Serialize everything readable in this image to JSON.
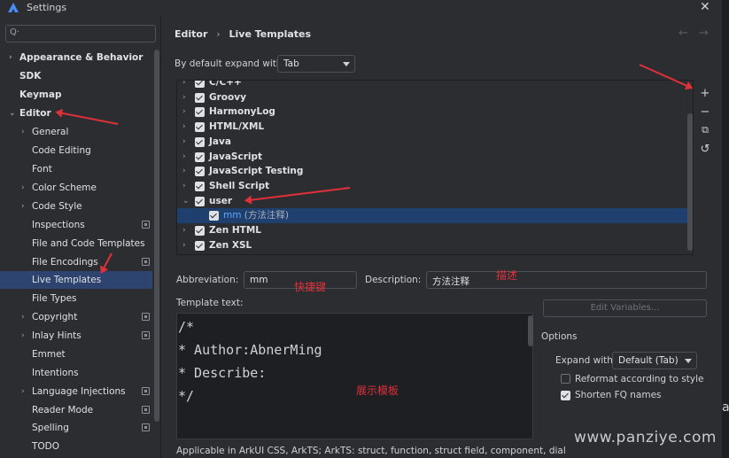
{
  "window": {
    "title": "Settings",
    "close": "✕"
  },
  "search": {
    "icon": "search-icon",
    "placeholder": "Q·"
  },
  "sidebar": {
    "items": [
      {
        "label": "Appearance & Behavior",
        "chevron": "›",
        "bold": true
      },
      {
        "label": "SDK",
        "bold": true
      },
      {
        "label": "Keymap",
        "bold": true
      },
      {
        "label": "Editor",
        "chevron": "⌄",
        "bold": true
      },
      {
        "label": "General",
        "chevron": "›"
      },
      {
        "label": "Code Editing"
      },
      {
        "label": "Font"
      },
      {
        "label": "Color Scheme",
        "chevron": "›"
      },
      {
        "label": "Code Style",
        "chevron": "›"
      },
      {
        "label": "Inspections",
        "badge": true
      },
      {
        "label": "File and Code Templates"
      },
      {
        "label": "File Encodings",
        "badge": true
      },
      {
        "label": "Live Templates",
        "selected": true
      },
      {
        "label": "File Types"
      },
      {
        "label": "Copyright",
        "chevron": "›",
        "badge": true
      },
      {
        "label": "Inlay Hints",
        "chevron": "›",
        "badge": true
      },
      {
        "label": "Emmet"
      },
      {
        "label": "Intentions"
      },
      {
        "label": "Language Injections",
        "chevron": "›",
        "badge": true
      },
      {
        "label": "Reader Mode",
        "badge": true
      },
      {
        "label": "Spelling",
        "badge": true
      },
      {
        "label": "TODO"
      }
    ]
  },
  "breadcrumb": {
    "parent": "Editor",
    "sep": "›",
    "current": "Live Templates"
  },
  "nav": {
    "back": "←",
    "forward": "→"
  },
  "expand": {
    "label": "By default expand with",
    "value": "Tab"
  },
  "template_groups": [
    {
      "label": "C/C++",
      "expanded": false
    },
    {
      "label": "Groovy",
      "expanded": false
    },
    {
      "label": "HarmonyLog",
      "expanded": false
    },
    {
      "label": "HTML/XML",
      "expanded": false
    },
    {
      "label": "Java",
      "expanded": false
    },
    {
      "label": "JavaScript",
      "expanded": false
    },
    {
      "label": "JavaScript Testing",
      "expanded": false
    },
    {
      "label": "Shell Script",
      "expanded": false
    },
    {
      "label": "user",
      "expanded": true
    },
    {
      "label": "mm",
      "desc": "(方法注释)",
      "child": true,
      "selected": true
    },
    {
      "label": "Zen HTML",
      "expanded": false
    },
    {
      "label": "Zen XSL",
      "expanded": false
    }
  ],
  "toolbar": {
    "add": "+",
    "remove": "−",
    "copy": "⧉",
    "undo": "↺"
  },
  "abbreviation": {
    "label": "Abbreviation:",
    "value": "mm"
  },
  "description": {
    "label": "Description:",
    "value": "方法注释"
  },
  "template_text": {
    "label": "Template text:",
    "lines": [
      "/*",
      "* Author:AbnerMing",
      "* Describe:",
      "*/"
    ]
  },
  "edit_variables": "Edit Variables...",
  "options": {
    "title": "Options",
    "expand_label": "Expand with",
    "expand_value": "Default (Tab)",
    "reformat": {
      "label": "Reformat according to style",
      "checked": false
    },
    "shorten": {
      "label": "Shorten FQ names",
      "checked": true
    }
  },
  "applicable": "Applicable in ArkUI CSS, ArkTS; ArkTS: struct, function, struct field, component, dial",
  "annotations": {
    "shortcut": "快捷键",
    "description": "描述",
    "display": "展示模板"
  },
  "watermark": "www.panziye.com",
  "side_char": "a",
  "colors": {
    "accent": "#2e436e",
    "annotation": "#e0303a",
    "selection": "#1f3f6e"
  }
}
